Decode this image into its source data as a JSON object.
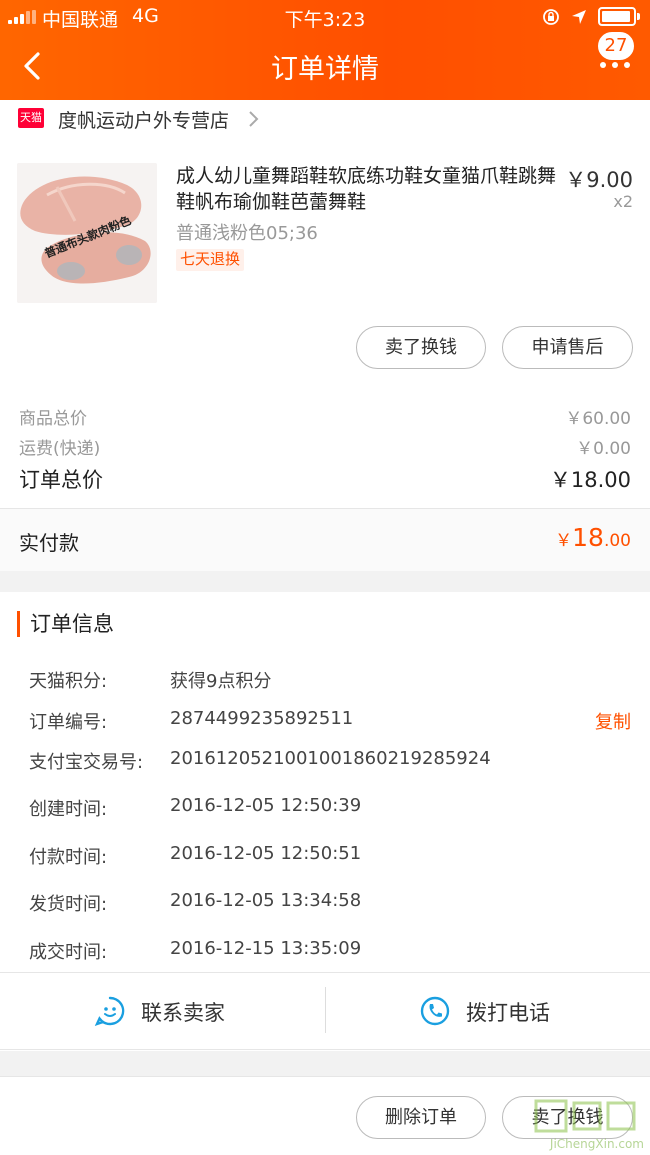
{
  "status_bar": {
    "carrier": "中国联通",
    "network": "4G",
    "time": "下午3:23"
  },
  "nav": {
    "title": "订单详情",
    "badge_count": "27"
  },
  "shop": {
    "logo_text": "天猫",
    "name": "度帆运动户外专营店"
  },
  "product": {
    "title": "成人幼儿童舞蹈鞋软底练功鞋女童猫爪鞋跳舞鞋帆布瑜伽鞋芭蕾舞鞋",
    "price": "￥9.00",
    "quantity": "x2",
    "sku": "普通浅粉色05;36",
    "tag": "七天退换",
    "image_caption": "普通布头款肉粉色"
  },
  "item_actions": {
    "sell": "卖了换钱",
    "after_sale": "申请售后"
  },
  "summary": {
    "goods_label": "商品总价",
    "goods_value": "￥60.00",
    "shipping_label": "运费(快递)",
    "shipping_value": "￥0.00",
    "total_label": "订单总价",
    "total_value": "￥18.00"
  },
  "paid": {
    "label": "实付款",
    "currency": "￥",
    "integer": "18",
    "decimal": ".00"
  },
  "order_info": {
    "title": "订单信息",
    "rows": [
      {
        "label": "天猫积分:",
        "value": "获得9点积分"
      },
      {
        "label": "订单编号:",
        "value": "2874499235892511",
        "action": "复制"
      },
      {
        "label": "支付宝交易号:",
        "value": "2016120521001001860219285924"
      },
      {
        "label": "创建时间:",
        "value": "2016-12-05 12:50:39"
      },
      {
        "label": "付款时间:",
        "value": "2016-12-05 12:50:51"
      },
      {
        "label": "发货时间:",
        "value": "2016-12-05 13:34:58"
      },
      {
        "label": "成交时间:",
        "value": "2016-12-15 13:35:09"
      }
    ]
  },
  "contact": {
    "seller": "联系卖家",
    "phone": "拨打电话"
  },
  "bottom_actions": {
    "delete": "删除订单",
    "sell": "卖了换钱"
  },
  "watermark": {
    "text": "JiChengXin.com"
  },
  "colors": {
    "accent": "#ff5000",
    "header": "#ff5a00",
    "contact_icon": "#1a9fe0"
  }
}
